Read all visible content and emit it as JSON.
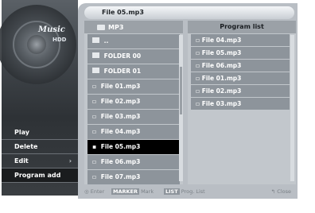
{
  "logo": {
    "title": "Music",
    "subtitle": "HDD"
  },
  "menu": {
    "items": [
      {
        "label": "Play"
      },
      {
        "label": "Delete"
      },
      {
        "label": "Edit",
        "arrow": "›"
      },
      {
        "label": "Program add"
      }
    ]
  },
  "title": "File 05.mp3",
  "file_list": {
    "folder": "MP3",
    "parent": "..",
    "items": [
      {
        "label": "FOLDER 00",
        "icon": "folder"
      },
      {
        "label": "FOLDER 01",
        "icon": "folder"
      },
      {
        "label": "File 01.mp3",
        "icon": "file"
      },
      {
        "label": "File 02.mp3",
        "icon": "file"
      },
      {
        "label": "File 03.mp3",
        "icon": "file"
      },
      {
        "label": "File 04.mp3",
        "icon": "file"
      },
      {
        "label": "File 05.mp3",
        "icon": "file"
      },
      {
        "label": "File 06.mp3",
        "icon": "file"
      },
      {
        "label": "File 07.mp3",
        "icon": "file"
      }
    ]
  },
  "program_list": {
    "header": "Program list",
    "items": [
      "File 04.mp3",
      "File 05.mp3",
      "File 06.mp3",
      "File 01.mp3",
      "File 02.mp3",
      "File 03.mp3"
    ]
  },
  "bottom": {
    "enter_icon": "◎",
    "enter": "Enter",
    "marker_key": "MARKER",
    "mark": "Mark",
    "list_key": "LIST",
    "prog_list": "Prog. List",
    "close_icon": "↰",
    "close": "Close"
  }
}
